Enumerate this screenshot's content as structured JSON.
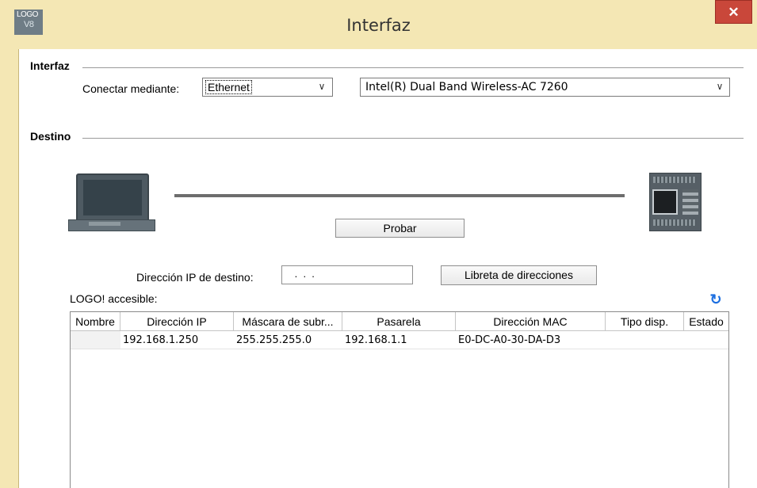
{
  "window": {
    "logo_text": "LOGO",
    "logo_version": "V8",
    "title": "Interfaz",
    "close_glyph": "✕"
  },
  "interface_section": {
    "legend": "Interfaz",
    "connect_label": "Conectar mediante:",
    "connect_value": "Ethernet",
    "adapter_value": "Intel(R) Dual Band Wireless-AC 7260"
  },
  "destination_section": {
    "legend": "Destino",
    "test_button": "Probar",
    "ip_label": "Dirección IP de destino:",
    "ip_value": " .  .  .",
    "address_book_button": "Libreta de direcciones",
    "accessible_label": "LOGO! accesible:"
  },
  "table": {
    "columns": [
      "Nombre",
      "Dirección IP",
      "Máscara de subr...",
      "Pasarela",
      "Dirección MAC",
      "Tipo disp.",
      "Estado"
    ],
    "rows": [
      [
        "",
        "192.168.1.250",
        "255.255.255.0",
        "192.168.1.1",
        "E0-DC-A0-30-DA-D3",
        "",
        ""
      ]
    ]
  },
  "icons": {
    "refresh": "refresh-icon",
    "chevron": "chevron-down-icon"
  },
  "colors": {
    "titlebar": "#f4e7b4",
    "close_button": "#c9473a",
    "refresh_icon": "#1d6fe0"
  }
}
